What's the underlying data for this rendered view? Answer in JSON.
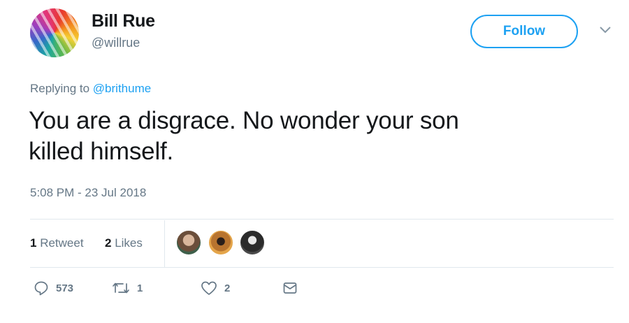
{
  "user": {
    "name": "Bill Rue",
    "handle": "@willrue",
    "follow_label": "Follow"
  },
  "reply": {
    "prefix": "Replying to",
    "to": "@brithume"
  },
  "tweet": {
    "line1": "You are a disgrace. No wonder your son",
    "line2": "killed himself.",
    "timestamp": "5:08 PM - 23 Jul 2018"
  },
  "stats": {
    "retweets_count": "1",
    "retweets_label": "Retweet",
    "likes_count": "2",
    "likes_label": "Likes"
  },
  "actions": {
    "reply_count": "573",
    "retweet_count": "1",
    "like_count": "2"
  },
  "colors": {
    "accent": "#1da1f2",
    "secondary_text": "#657786",
    "divider": "#e1e8ed"
  },
  "icons": [
    "profile-avatar",
    "chevron-down-icon",
    "reply-icon",
    "retweet-icon",
    "heart-icon",
    "message-icon"
  ]
}
